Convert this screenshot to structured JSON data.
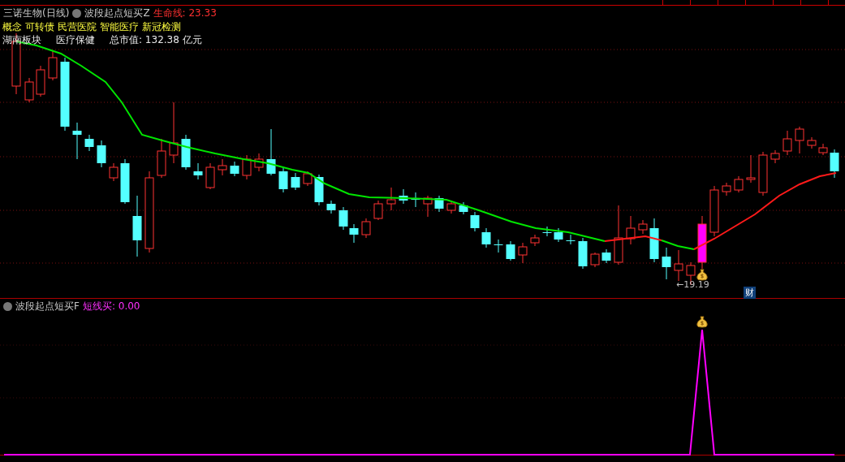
{
  "main_panel": {
    "title": "三诺生物(日线)",
    "indicator": "波段起点短买Z",
    "lifeline": "生命线: 23.33",
    "concept_label": "概念",
    "concept_tags": [
      "可转债",
      "民营医院",
      "智能医疗",
      "新冠检测"
    ],
    "region": "湖南板块",
    "industry": "医疗保健",
    "market_cap": "总市值: 132.38 亿元",
    "low_marker": "←19.19",
    "badge": "财"
  },
  "lower_panel": {
    "indicator": "波段起点短买F",
    "reading": "短线买: 0.00"
  }
}
